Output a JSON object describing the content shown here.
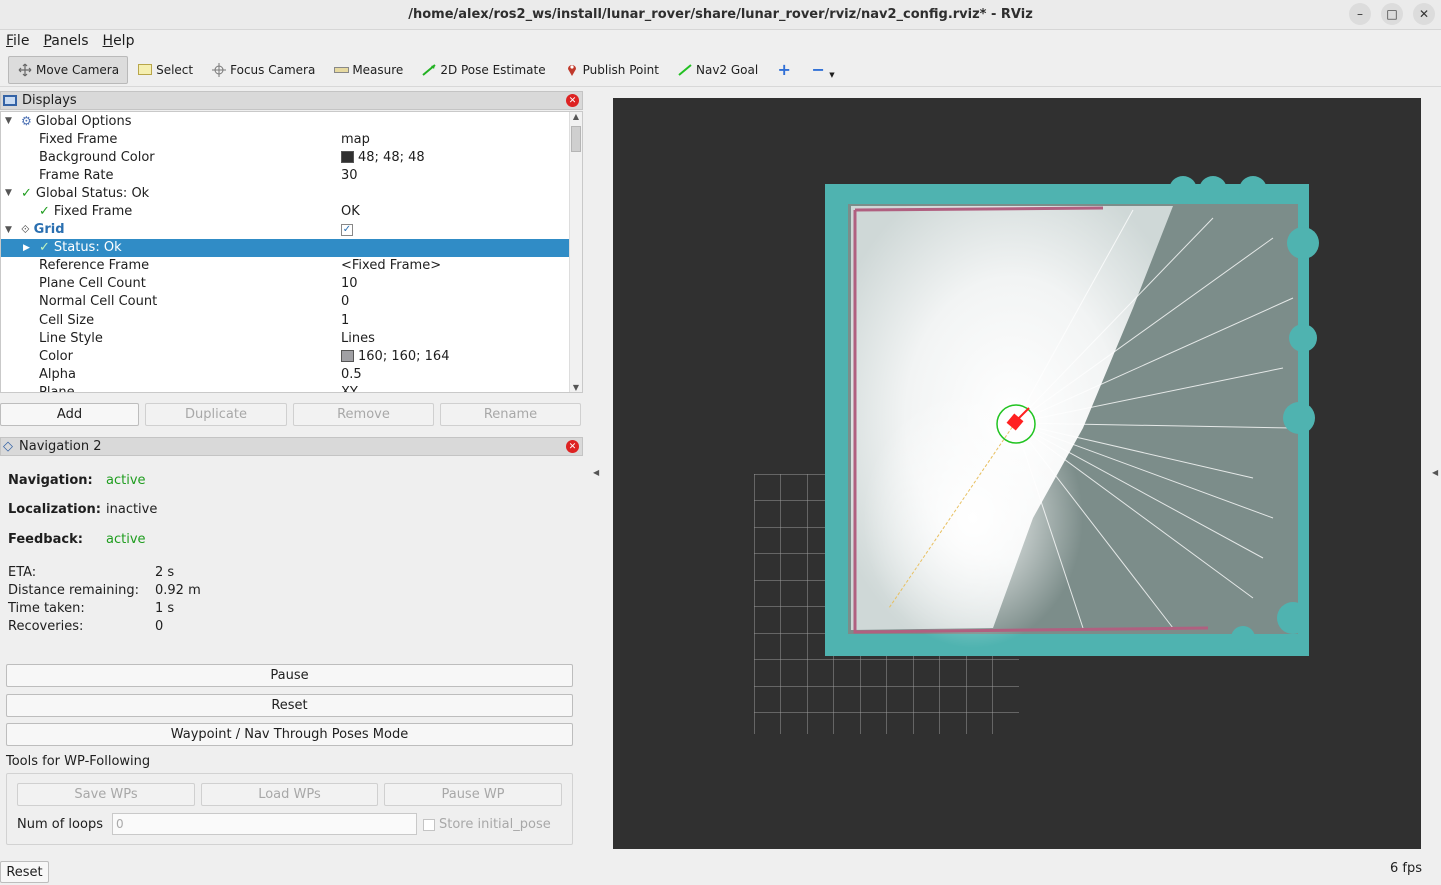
{
  "window": {
    "title": "/home/alex/ros2_ws/install/lunar_rover/share/lunar_rover/rviz/nav2_config.rviz* - RViz"
  },
  "menu": [
    "File",
    "Panels",
    "Help"
  ],
  "toolbar": {
    "move_camera": "Move Camera",
    "select": "Select",
    "focus_camera": "Focus Camera",
    "measure": "Measure",
    "pose_estimate": "2D Pose Estimate",
    "publish_point": "Publish Point",
    "nav2_goal": "Nav2 Goal"
  },
  "displays": {
    "title": "Displays",
    "rows": {
      "global_options": "Global Options",
      "fixed_frame": "Fixed Frame",
      "fixed_frame_val": "map",
      "bg_color": "Background Color",
      "bg_color_val": "48; 48; 48",
      "frame_rate": "Frame Rate",
      "frame_rate_val": "30",
      "global_status": "Global Status: Ok",
      "fixed_frame_status": "Fixed Frame",
      "fixed_frame_status_val": "OK",
      "grid": "Grid",
      "status_ok": "Status: Ok",
      "ref_frame": "Reference Frame",
      "ref_frame_val": "<Fixed Frame>",
      "plane_cells": "Plane Cell Count",
      "plane_cells_val": "10",
      "normal_cells": "Normal Cell Count",
      "normal_cells_val": "0",
      "cell_size": "Cell Size",
      "cell_size_val": "1",
      "line_style": "Line Style",
      "line_style_val": "Lines",
      "color": "Color",
      "color_val": "160; 160; 164",
      "alpha": "Alpha",
      "alpha_val": "0.5",
      "plane": "Plane",
      "plane_val": "XY"
    },
    "colors": {
      "bg_swatch": "#303030",
      "grid_swatch": "#a0a0a4",
      "selection": "#308cc6"
    },
    "buttons": {
      "add": "Add",
      "duplicate": "Duplicate",
      "remove": "Remove",
      "rename": "Rename"
    }
  },
  "navigation": {
    "title": "Navigation 2",
    "navigation_label": "Navigation:",
    "navigation_val": "active",
    "localization_label": "Localization:",
    "localization_val": "inactive",
    "feedback_label": "Feedback:",
    "feedback_val": "active",
    "eta_label": "ETA:",
    "eta_val": "2 s",
    "distance_label": "Distance remaining:",
    "distance_val": "0.92 m",
    "time_label": "Time taken:",
    "time_val": "1 s",
    "recoveries_label": "Recoveries:",
    "recoveries_val": "0",
    "pause": "Pause",
    "reset": "Reset",
    "waypoint_mode": "Waypoint / Nav Through Poses Mode",
    "wp_tools_title": "Tools for WP-Following",
    "save_wps": "Save WPs",
    "load_wps": "Load WPs",
    "pause_wp": "Pause WP",
    "num_loops_label": "Num of loops",
    "num_loops_placeholder": "0",
    "store_initial_pose": "Store initial_pose"
  },
  "status": {
    "reset": "Reset",
    "fps": "6 fps"
  },
  "viewport": {
    "background": "#303030",
    "costmap": "#4fb3b0",
    "free": "#ffffff",
    "unknown": "#7c8d8a",
    "robot": "#ff2020",
    "goal_ring": "#21c421"
  }
}
